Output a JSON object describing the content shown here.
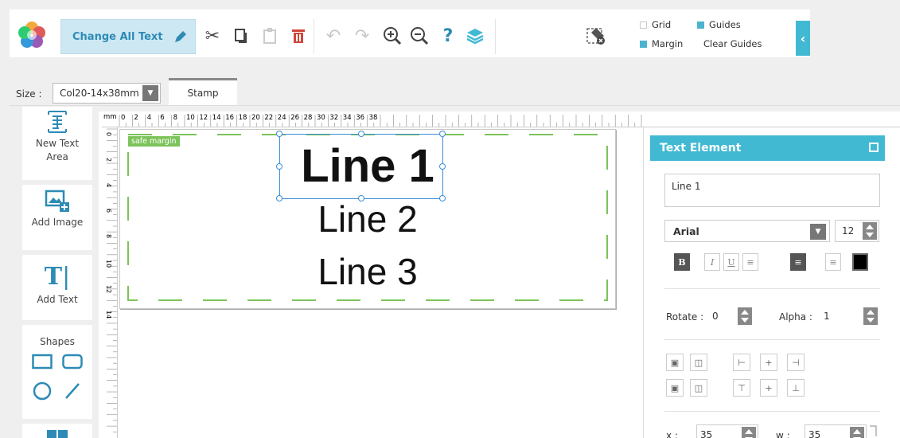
{
  "toolbar": {
    "change_all_text": "Change All Text",
    "checks": {
      "grid": "Grid",
      "guides": "Guides",
      "margin": "Margin",
      "clear_guides": "Clear Guides"
    },
    "icons": [
      "cut-icon",
      "copy-icon",
      "paste-icon",
      "delete-icon",
      "undo-icon",
      "redo-icon",
      "zoom-in-icon",
      "zoom-out-icon",
      "help-icon",
      "layers-icon",
      "clear-format-icon"
    ]
  },
  "size_row": {
    "label": "Size :",
    "value": "Col20-14x38mm",
    "tab": "Stamp"
  },
  "left_panel": {
    "new_text_area": "New Text Area",
    "add_image": "Add Image",
    "add_text": "Add Text",
    "shapes": "Shapes"
  },
  "ruler": {
    "unit": "mm",
    "top_labels": [
      "0",
      "2",
      "4",
      "6",
      "8",
      "10",
      "12",
      "14",
      "16",
      "18",
      "20",
      "22",
      "24",
      "26",
      "28",
      "30",
      "32",
      "34",
      "36",
      "38"
    ],
    "left_labels": [
      "0",
      "2",
      "4",
      "6",
      "8",
      "10",
      "12",
      "14"
    ]
  },
  "canvas": {
    "safe_margin": "safe margin",
    "lines": [
      "Line 1",
      "Line 2",
      "Line 3"
    ]
  },
  "text_panel": {
    "title": "Text Element",
    "text_value": "Line 1",
    "font": "Arial",
    "font_size": "12",
    "rotate_label": "Rotate :",
    "rotate_value": "0",
    "alpha_label": "Alpha :",
    "alpha_value": "1",
    "x_label": "x :",
    "x_value": "35",
    "w_label": "w :",
    "w_value": "35"
  },
  "colors": {
    "accent": "#42b9d2",
    "selection": "#3b8dd6",
    "guide": "#7cc35a",
    "delete": "#d0453d"
  }
}
